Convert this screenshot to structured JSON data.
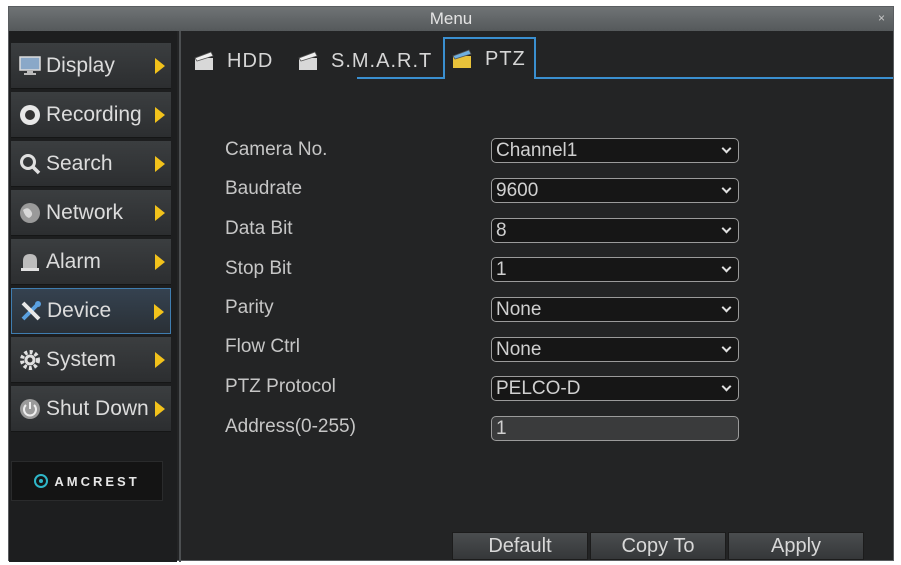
{
  "window": {
    "title": "Menu",
    "close_symbol": "×"
  },
  "sidebar": {
    "items": [
      {
        "label": "Display",
        "icon": "monitor-icon"
      },
      {
        "label": "Recording",
        "icon": "record-icon"
      },
      {
        "label": "Search",
        "icon": "search-icon"
      },
      {
        "label": "Network",
        "icon": "globe-icon"
      },
      {
        "label": "Alarm",
        "icon": "bell-icon"
      },
      {
        "label": "Device",
        "icon": "tools-icon",
        "active": true
      },
      {
        "label": "System",
        "icon": "gear-icon"
      },
      {
        "label": "Shut Down",
        "icon": "power-icon"
      }
    ],
    "logo_text": "AMCREST"
  },
  "tabs": [
    {
      "label": "HDD"
    },
    {
      "label": "S.M.A.R.T"
    },
    {
      "label": "PTZ",
      "active": true
    }
  ],
  "form": {
    "camera_no": {
      "label": "Camera No.",
      "value": "Channel1"
    },
    "baudrate": {
      "label": "Baudrate",
      "value": "9600"
    },
    "data_bit": {
      "label": "Data Bit",
      "value": "8"
    },
    "stop_bit": {
      "label": "Stop Bit",
      "value": "1"
    },
    "parity": {
      "label": "Parity",
      "value": "None"
    },
    "flow_ctrl": {
      "label": "Flow Ctrl",
      "value": "None"
    },
    "ptz_protocol": {
      "label": "PTZ Protocol",
      "value": "PELCO-D"
    },
    "address": {
      "label": "Address(0-255)",
      "value": "1"
    }
  },
  "buttons": {
    "default": "Default",
    "copy_to": "Copy To",
    "apply": "Apply"
  },
  "colors": {
    "accent": "#3a8fd0",
    "arrow": "#f2c21b",
    "background": "#232425"
  }
}
